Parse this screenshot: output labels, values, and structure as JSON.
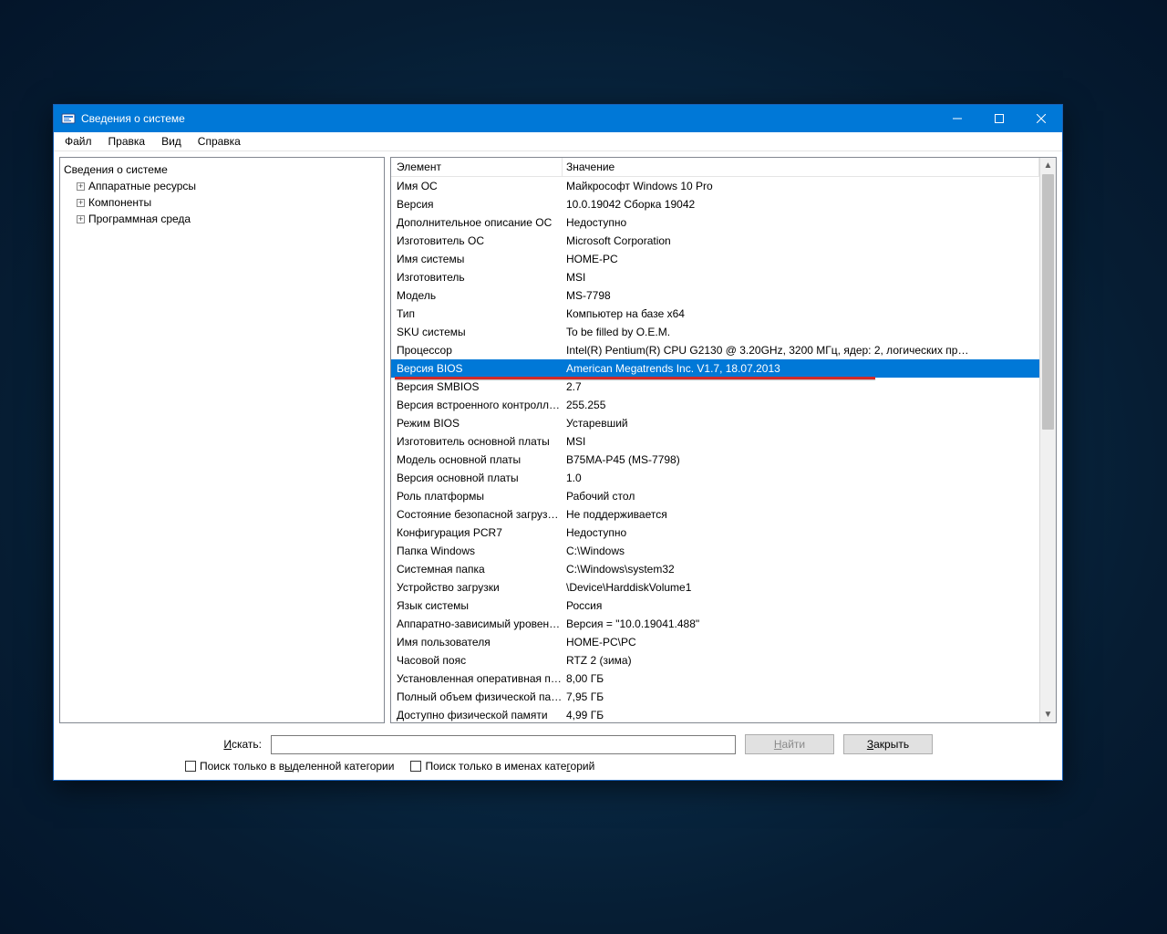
{
  "window": {
    "title": "Сведения о системе"
  },
  "menu": {
    "file": "Файл",
    "edit": "Правка",
    "view": "Вид",
    "help": "Справка"
  },
  "tree": {
    "root": "Сведения о системе",
    "children": [
      {
        "label": "Аппаратные ресурсы",
        "expandable": true
      },
      {
        "label": "Компоненты",
        "expandable": true
      },
      {
        "label": "Программная среда",
        "expandable": true
      }
    ]
  },
  "list": {
    "header_el": "Элемент",
    "header_val": "Значение",
    "selected_index": 10,
    "rows": [
      {
        "el": "Имя ОС",
        "val": "Майкрософт Windows 10 Pro"
      },
      {
        "el": "Версия",
        "val": "10.0.19042 Сборка 19042"
      },
      {
        "el": "Дополнительное описание ОС",
        "val": "Недоступно"
      },
      {
        "el": "Изготовитель ОС",
        "val": "Microsoft Corporation"
      },
      {
        "el": "Имя системы",
        "val": "HOME-PC"
      },
      {
        "el": "Изготовитель",
        "val": "MSI"
      },
      {
        "el": "Модель",
        "val": "MS-7798"
      },
      {
        "el": "Тип",
        "val": "Компьютер на базе x64"
      },
      {
        "el": "SKU системы",
        "val": "To be filled by O.E.M."
      },
      {
        "el": "Процессор",
        "val": "Intel(R) Pentium(R) CPU G2130 @ 3.20GHz, 3200 МГц, ядер: 2, логических пр…"
      },
      {
        "el": "Версия BIOS",
        "val": "American Megatrends Inc. V1.7, 18.07.2013"
      },
      {
        "el": "Версия SMBIOS",
        "val": "2.7"
      },
      {
        "el": "Версия встроенного контролл…",
        "val": "255.255"
      },
      {
        "el": "Режим BIOS",
        "val": "Устаревший"
      },
      {
        "el": "Изготовитель основной платы",
        "val": "MSI"
      },
      {
        "el": "Модель основной платы",
        "val": "B75MA-P45 (MS-7798)"
      },
      {
        "el": "Версия основной платы",
        "val": "1.0"
      },
      {
        "el": "Роль платформы",
        "val": "Рабочий стол"
      },
      {
        "el": "Состояние безопасной загруз…",
        "val": "Не поддерживается"
      },
      {
        "el": "Конфигурация PCR7",
        "val": "Недоступно"
      },
      {
        "el": "Папка Windows",
        "val": "C:\\Windows"
      },
      {
        "el": "Системная папка",
        "val": "C:\\Windows\\system32"
      },
      {
        "el": "Устройство загрузки",
        "val": "\\Device\\HarddiskVolume1"
      },
      {
        "el": "Язык системы",
        "val": "Россия"
      },
      {
        "el": "Аппаратно-зависимый уровен…",
        "val": "Версия = \"10.0.19041.488\""
      },
      {
        "el": "Имя пользователя",
        "val": "HOME-PC\\PC"
      },
      {
        "el": "Часовой пояс",
        "val": "RTZ 2 (зима)"
      },
      {
        "el": "Установленная оперативная п…",
        "val": "8,00 ГБ"
      },
      {
        "el": "Полный объем физической па…",
        "val": "7,95 ГБ"
      },
      {
        "el": "Доступно физической памяти",
        "val": "4,99 ГБ"
      }
    ]
  },
  "search": {
    "label_prefix": "И",
    "label_rest": "скать:",
    "placeholder": "",
    "find_btn_prefix": "Н",
    "find_btn_rest": "айти",
    "close_btn_prefix": "З",
    "close_btn_rest": "акрыть",
    "cb1_prefix": "Поиск только в в",
    "cb1_u": "ы",
    "cb1_rest": "деленной категории",
    "cb2_prefix": "Поиск только в именах кате",
    "cb2_u": "г",
    "cb2_rest": "орий"
  }
}
